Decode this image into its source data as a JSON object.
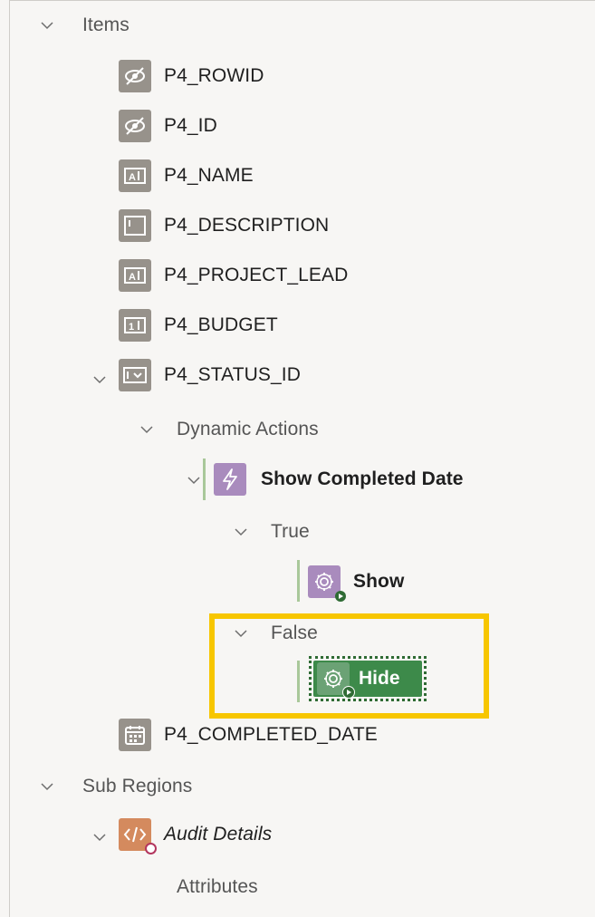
{
  "tree": {
    "items_header": "Items",
    "items": [
      {
        "label": "P4_ROWID",
        "icon": "hidden-item-icon"
      },
      {
        "label": "P4_ID",
        "icon": "hidden-item-icon"
      },
      {
        "label": "P4_NAME",
        "icon": "text-field-icon"
      },
      {
        "label": "P4_DESCRIPTION",
        "icon": "textarea-icon"
      },
      {
        "label": "P4_PROJECT_LEAD",
        "icon": "text-field-icon"
      },
      {
        "label": "P4_BUDGET",
        "icon": "number-field-icon"
      },
      {
        "label": "P4_STATUS_ID",
        "icon": "select-list-icon"
      }
    ],
    "dynamic_actions_header": "Dynamic Actions",
    "dynamic_action": "Show Completed Date",
    "true_header": "True",
    "true_action": "Show",
    "false_header": "False",
    "false_action": "Hide",
    "completed_date": "P4_COMPLETED_DATE",
    "sub_regions_header": "Sub Regions",
    "sub_region": "Audit Details",
    "attributes": "Attributes"
  },
  "colors": {
    "highlight": "#f7c600",
    "selected_node": "#3d8a4a",
    "item_icon": "#97928b",
    "dynamic_action_icon": "#a98bbd",
    "region_icon": "#d48a5e"
  }
}
